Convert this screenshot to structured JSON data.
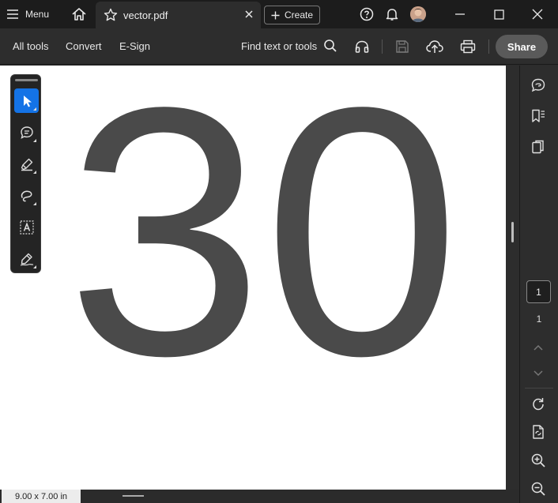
{
  "titlebar": {
    "menu_label": "Menu",
    "tab_title": "vector.pdf",
    "create_label": "Create"
  },
  "toolbar": {
    "all_tools": "All tools",
    "convert": "Convert",
    "esign": "E-Sign",
    "find_label": "Find text or tools",
    "share_label": "Share"
  },
  "document": {
    "content": "30",
    "page_size": "9.00 x 7.00 in"
  },
  "pagination": {
    "current_page": "1",
    "total_pages": "1"
  },
  "colors": {
    "accent": "#1473e6",
    "text_gray": "#4a4a4a"
  }
}
